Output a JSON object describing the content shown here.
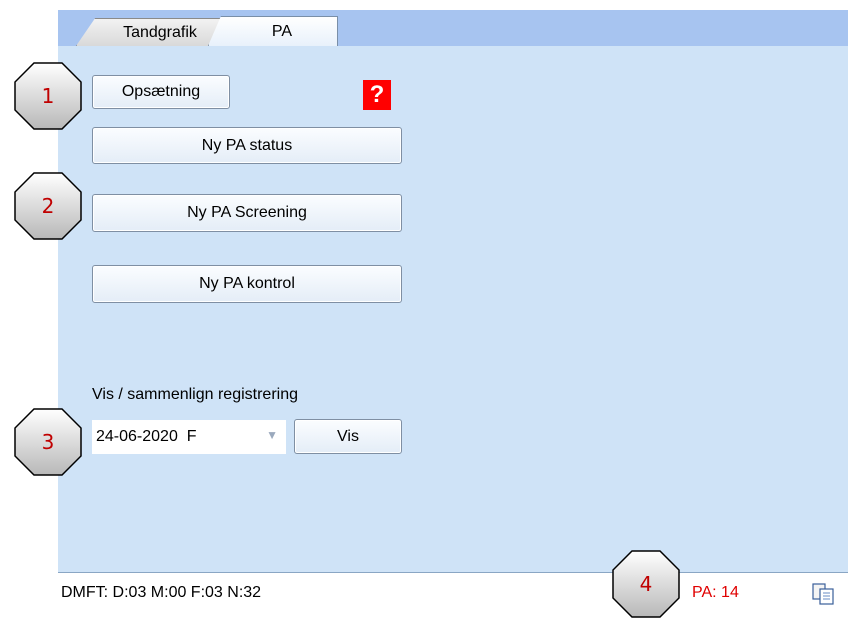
{
  "tabs": [
    {
      "label": "Tandgrafik",
      "active": false
    },
    {
      "label": "PA",
      "active": true
    }
  ],
  "toolbar": {
    "setup_label": "Opsætning",
    "help_label": "?"
  },
  "actions": {
    "new_status_label": "Ny PA status",
    "new_screening_label": "Ny PA Screening",
    "new_control_label": "Ny PA kontrol"
  },
  "compare": {
    "label": "Vis / sammenlign registrering",
    "selected": "24-06-2020  F",
    "show_label": "Vis"
  },
  "status": {
    "dmft": "DMFT: D:03 M:00 F:03 N:32",
    "pa": "PA: 14"
  },
  "markers": [
    "1",
    "2",
    "3",
    "4"
  ],
  "colors": {
    "panel_bg": "#cfe3f7",
    "tabstrip_bg": "#a7c4f0",
    "help_bg": "#ff0000",
    "pa_text": "#e00000",
    "marker_text": "#c00000"
  }
}
